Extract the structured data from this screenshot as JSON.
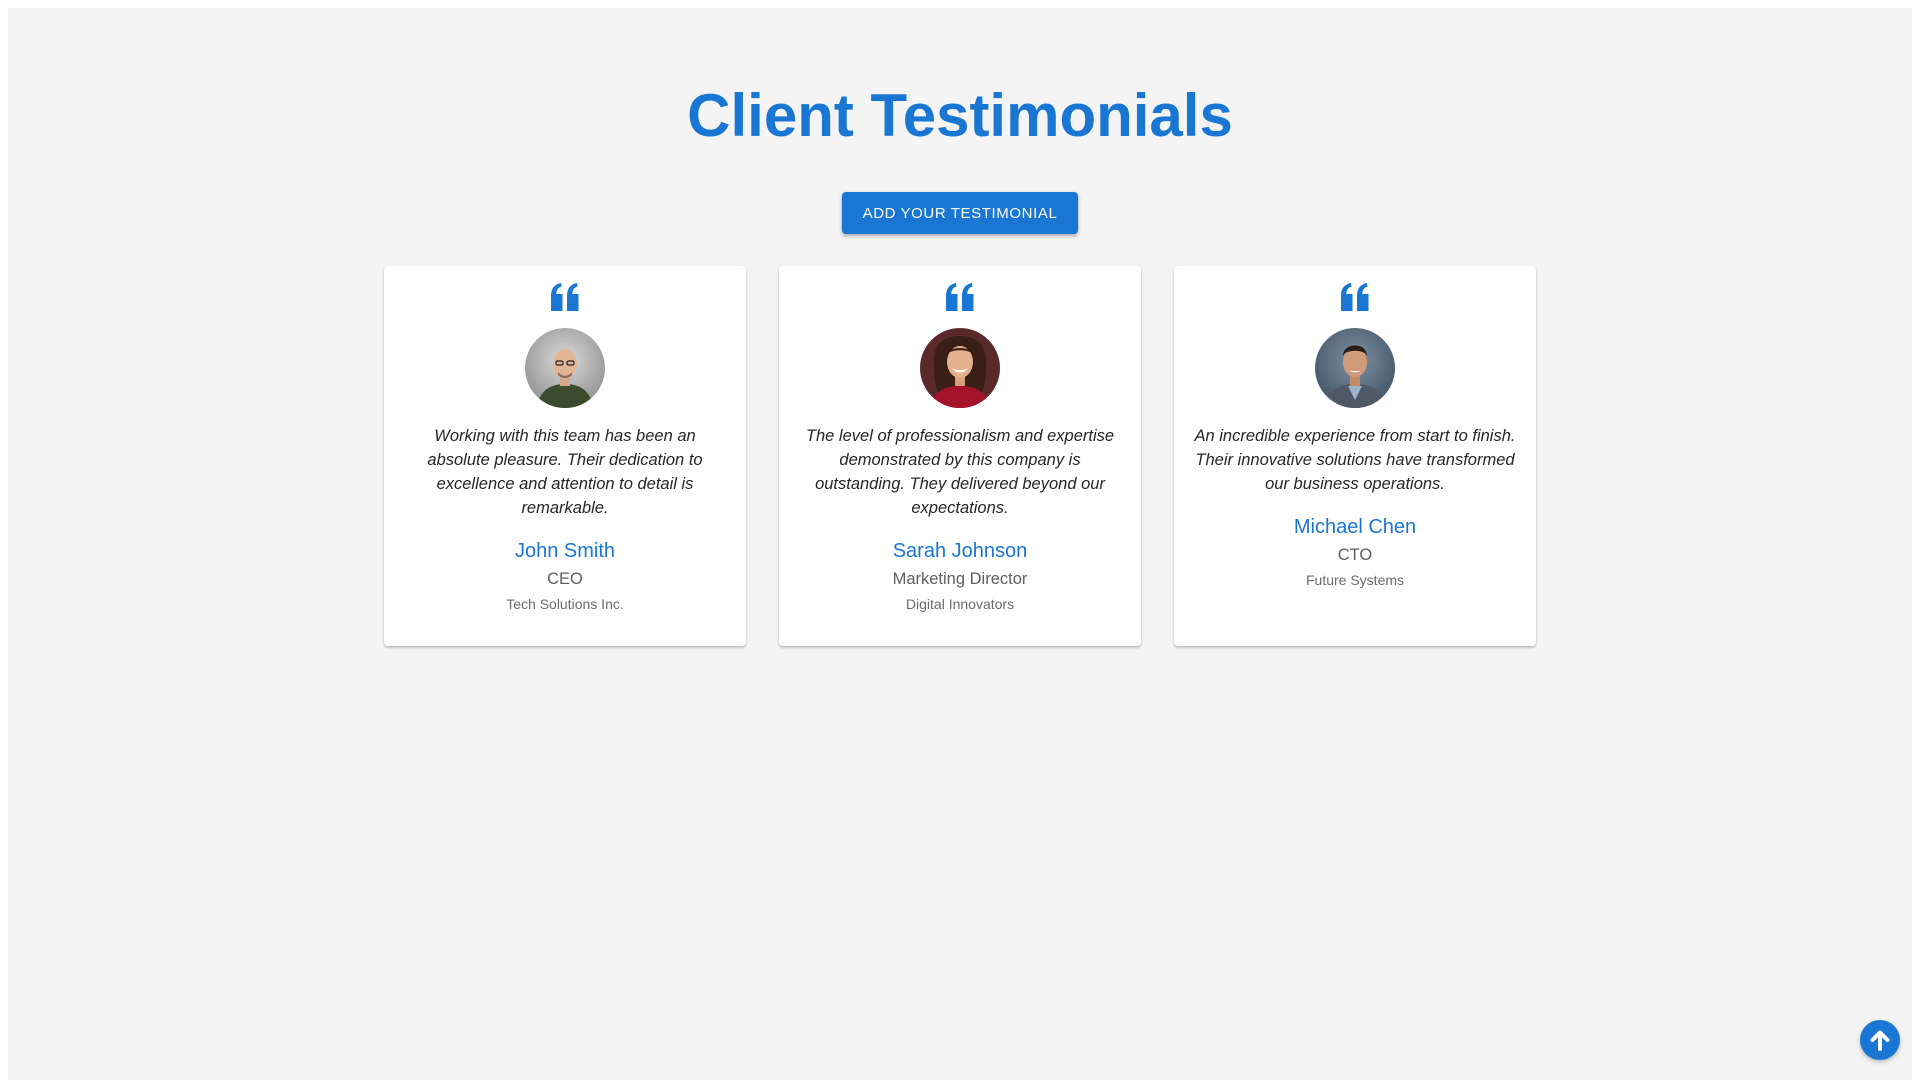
{
  "page": {
    "title": "Client Testimonials",
    "add_button_label": "ADD YOUR TESTIMONIAL"
  },
  "icons": {
    "quote": "quote-icon",
    "scroll_top": "arrow-up-circle-icon"
  },
  "colors": {
    "accent": "#1976d2",
    "background": "#f4f4f5",
    "card": "#ffffff"
  },
  "testimonials": [
    {
      "quote": "Working with this team has been an absolute pleasure. Their dedication to excellence and attention to detail is remarkable.",
      "name": "John Smith",
      "role": "CEO",
      "company": "Tech Solutions Inc."
    },
    {
      "quote": "The level of professionalism and expertise demonstrated by this company is outstanding. They delivered beyond our expectations.",
      "name": "Sarah Johnson",
      "role": "Marketing Director",
      "company": "Digital Innovators"
    },
    {
      "quote": "An incredible experience from start to finish. Their innovative solutions have transformed our business operations.",
      "name": "Michael Chen",
      "role": "CTO",
      "company": "Future Systems"
    }
  ]
}
